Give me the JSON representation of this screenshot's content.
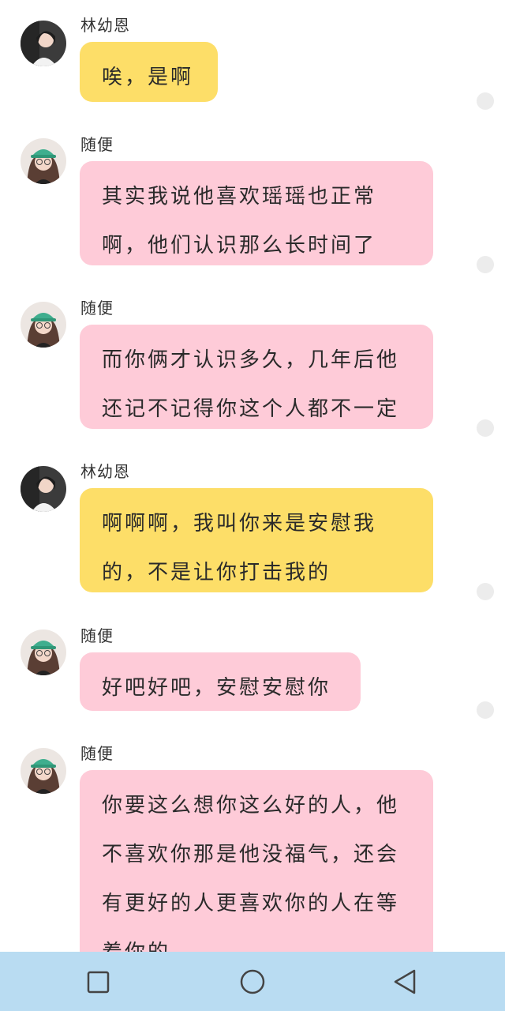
{
  "messages": [
    {
      "sender": "林幼恩",
      "text": "唉，是啊",
      "color": "#fdde68"
    },
    {
      "sender": "随便",
      "text": "其实我说他喜欢瑶瑶也正常\n啊，他们认识那么长时间了",
      "color": "#fecbd8"
    },
    {
      "sender": "随便",
      "text": "而你俩才认识多久，几年后他\n还记不记得你这个人都不一定",
      "color": "#fecbd8"
    },
    {
      "sender": "林幼恩",
      "text": "啊啊啊，我叫你来是安慰我\n的，不是让你打击我的",
      "color": "#fdde68"
    },
    {
      "sender": "随便",
      "text": "好吧好吧，安慰安慰你",
      "color": "#fecbd8"
    },
    {
      "sender": "随便",
      "text": "你要这么想你这么好的人，他\n不喜欢你那是他没福气，还会\n有更好的人更喜欢你的人在等\n着你的",
      "color": "#fecbd8"
    }
  ],
  "navbar": {
    "background": "#b9dcf2",
    "buttons": [
      "square-recents-icon",
      "circle-home-icon",
      "triangle-back-icon"
    ]
  }
}
